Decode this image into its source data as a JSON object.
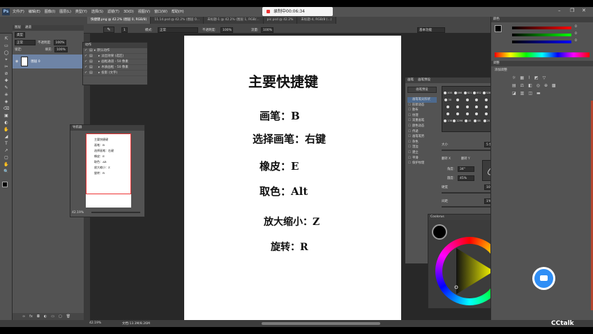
{
  "app": {
    "logo": "Ps",
    "menu": [
      "文件(F)",
      "编辑(E)",
      "图像(I)",
      "图层(L)",
      "类型(Y)",
      "选择(S)",
      "滤镜(T)",
      "3D(D)",
      "视图(V)",
      "窗口(W)",
      "帮助(H)"
    ]
  },
  "recording": {
    "label": "录制中00:06:34"
  },
  "options": {
    "brush_size": "1",
    "mode_label": "模式:",
    "mode_value": "正常",
    "opacity_label": "不透明度:",
    "opacity_value": "100%",
    "flow_label": "流量:",
    "flow_value": "100%",
    "workspace": "基本功能"
  },
  "tabs": [
    "快捷键.png @ 42.2% (图层 0, RGB/8)",
    "11.14.psd @ 42.2% (图层 0...",
    "未标题-1 @ 42.2% (图层 1, RGB/...",
    "pic.psd @ 42.2%",
    "未标题-4, RGB/8 (...)"
  ],
  "layers": {
    "tabs": [
      "图层",
      "通道"
    ],
    "kind": "类型",
    "mode": "正常",
    "opacity_label": "不透明度:",
    "opacity": "100%",
    "lock_label": "锁定:",
    "fill_label": "填充:",
    "fill": "100%",
    "layer_name": "图层 0"
  },
  "actions": {
    "title": "动作",
    "items": [
      "默认动作",
      "淡出效果 (选区)",
      "画框通道 - 50 像素",
      "木质画框 - 50 像素",
      "投影 (文字)"
    ]
  },
  "navigator": {
    "title": "导航器",
    "zoom": "42.19%"
  },
  "document": {
    "lines": [
      "主要快捷键",
      "画笔：B",
      "选择画笔：右键",
      "橡皮：E",
      "取色：Alt",
      "放大缩小：Z",
      "旋转：R"
    ]
  },
  "brush": {
    "tabs": [
      "画笔",
      "画笔预设"
    ],
    "preset_button": "画笔预设",
    "list": [
      "画笔笔尖形状",
      "形状动态",
      "散布",
      "纹理",
      "双重画笔",
      "颜色动态",
      "传递",
      "画笔笔势",
      "杂色",
      "湿边",
      "建立",
      "平滑",
      "保护纹理"
    ],
    "tip_sizes": [
      "400",
      "466",
      "621",
      "652",
      "528",
      "",
      "30",
      "",
      "",
      "",
      "",
      "",
      "",
      "",
      "",
      "",
      "",
      "",
      "",
      "",
      "",
      "",
      "",
      "",
      "136",
      "2296",
      "45",
      "68",
      "20",
      "70"
    ],
    "size_label": "大小",
    "size_value": "5 像素",
    "flipx": "翻转 X",
    "flipy": "翻转 Y",
    "angle_label": "角度:",
    "angle_value": "34°",
    "roundness_label": "圆度:",
    "roundness_value": "45%",
    "hardness_label": "硬度",
    "hardness_value": "100%",
    "spacing_label": "间距",
    "spacing_value": "1%"
  },
  "coolorus": {
    "title": "Coolorus"
  },
  "color": {
    "title": "颜色",
    "values": [
      "0",
      "0",
      "0"
    ]
  },
  "adjust": {
    "title": "调整",
    "add_label": "添加调整"
  },
  "status": {
    "zoom": "42.19%",
    "doc": "文档:13.3M/8.26M",
    "brand": "CCtalk"
  },
  "colors": {
    "accent": "#2f8ef5",
    "swatch_fg": "#000000"
  }
}
